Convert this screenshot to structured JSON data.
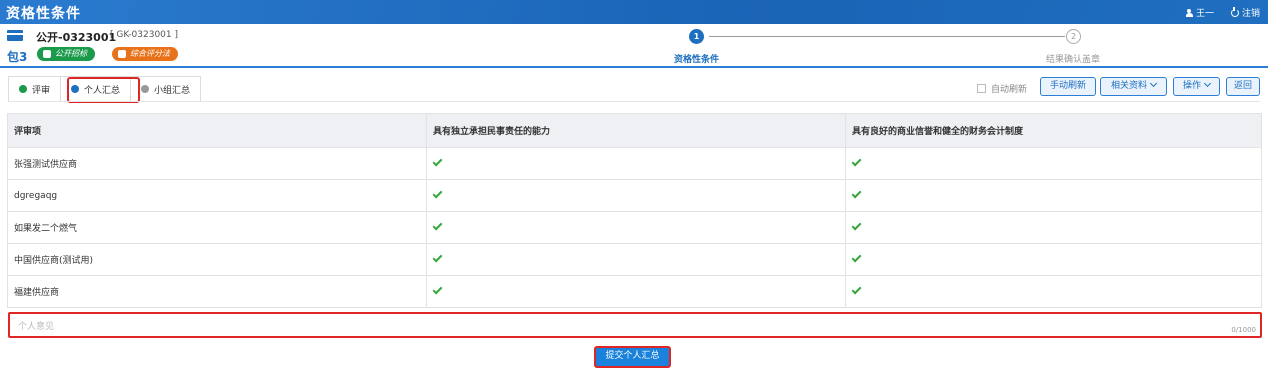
{
  "header": {
    "title": "资格性条件",
    "user": "王一",
    "logout": "注销"
  },
  "package": {
    "code": "公开-0323001",
    "code_bracket": "[ GK-0323001 ]",
    "name": "包3",
    "badge_method": "公开招标",
    "badge_eval": "综合评分法"
  },
  "steps": [
    {
      "number": "1",
      "label": "资格性条件",
      "active": true
    },
    {
      "number": "2",
      "label": "结果确认盖章",
      "active": false
    }
  ],
  "tabs": [
    {
      "label": "评审",
      "dot_color": "#1b9a4c"
    },
    {
      "label": "个人汇总",
      "dot_color": "#1f6fc0"
    },
    {
      "label": "小组汇总",
      "dot_color": "#999999"
    }
  ],
  "toolbar": {
    "auto_refresh": "自动刷新",
    "manual_refresh": "手动刷新",
    "related": "相关资料",
    "actions": "操作",
    "back": "返回"
  },
  "table": {
    "headers": [
      "评审项",
      "具有独立承担民事责任的能力",
      "具有良好的商业信誉和健全的财务会计制度"
    ],
    "rows": [
      {
        "supplier": "张强测试供应商",
        "c1": "pass",
        "c2": "pass"
      },
      {
        "supplier": "dgregaqg",
        "c1": "pass",
        "c2": "pass"
      },
      {
        "supplier": "如果发二个燃气",
        "c1": "pass",
        "c2": "pass"
      },
      {
        "supplier": "中国供应商(测试用)",
        "c1": "pass",
        "c2": "pass"
      },
      {
        "supplier": "福建供应商",
        "c1": "pass",
        "c2": "pass"
      }
    ]
  },
  "opinion": {
    "placeholder": "个人意见",
    "counter": "0/1000"
  },
  "submit_label": "提交个人汇总",
  "colors": {
    "brand": "#1f6fc0",
    "highlight": "#e02525",
    "check": "#3aa53a"
  }
}
